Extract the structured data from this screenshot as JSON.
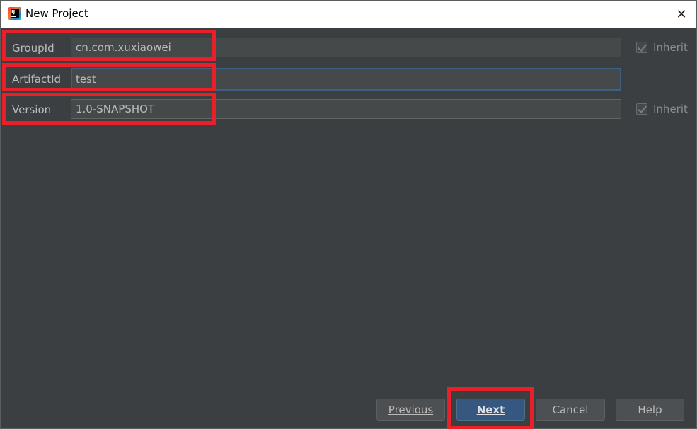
{
  "window": {
    "title": "New Project",
    "close_glyph": "✕"
  },
  "fields": {
    "group_id": {
      "label": "GroupId",
      "value": "cn.com.xuxiaowei",
      "inherit_label": "Inherit",
      "inherit_checked": true
    },
    "artifact_id": {
      "label": "ArtifactId",
      "value": "test"
    },
    "version": {
      "label": "Version",
      "value": "1.0-SNAPSHOT",
      "inherit_label": "Inherit",
      "inherit_checked": true
    }
  },
  "buttons": {
    "previous": "Previous",
    "next": "Next",
    "cancel": "Cancel",
    "help": "Help"
  },
  "colors": {
    "background": "#3c3f41",
    "primary_button": "#365880",
    "highlight": "#e8202a",
    "focus_border": "#3d6185"
  },
  "icons": {
    "app": "intellij-idea-icon",
    "close": "close-icon",
    "checkbox": "checkmark-icon"
  }
}
